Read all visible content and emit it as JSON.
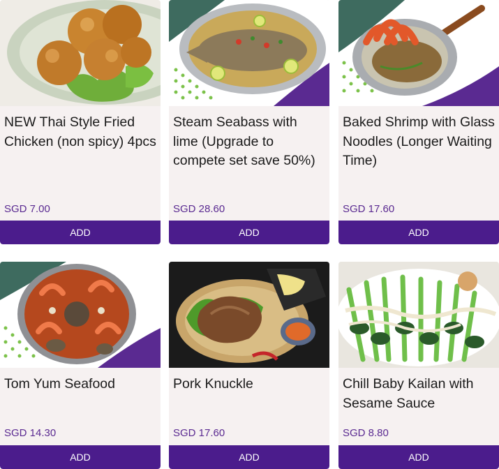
{
  "products": [
    {
      "name": "NEW Thai Style Fried Chicken (non spicy) 4pcs",
      "price": "SGD 7.00",
      "add_label": "ADD",
      "image": "fried-chicken-image"
    },
    {
      "name": "Steam Seabass with lime (Upgrade to compete set save 50%)",
      "price": "SGD 28.60",
      "add_label": "ADD",
      "image": "steamed-seabass-image"
    },
    {
      "name": "Baked Shrimp with Glass Noodles (Longer Waiting Time)",
      "price": "SGD 17.60",
      "add_label": "ADD",
      "image": "baked-shrimp-image"
    },
    {
      "name": "Tom Yum Seafood",
      "price": "SGD 14.30",
      "add_label": "ADD",
      "image": "tom-yum-image"
    },
    {
      "name": "Pork Knuckle",
      "price": "SGD 17.60",
      "add_label": "ADD",
      "image": "pork-knuckle-image"
    },
    {
      "name": "Chill Baby Kailan with Sesame Sauce",
      "price": "SGD 8.80",
      "add_label": "ADD",
      "image": "baby-kailan-image"
    }
  ],
  "colors": {
    "accent": "#4b1c8c",
    "price": "#5a2a91",
    "card_bg": "#f6f1f1",
    "teal": "#3e6b5f",
    "green_dot": "#7cc24a"
  }
}
